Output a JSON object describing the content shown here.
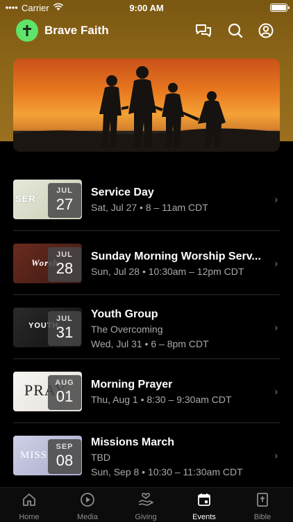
{
  "status_bar": {
    "carrier": "Carrier",
    "time": "9:00 AM"
  },
  "header": {
    "title": "Brave Faith",
    "icons": [
      "chat-icon",
      "search-icon",
      "profile-icon"
    ],
    "logo_color": "#5fe36a"
  },
  "hero": {
    "image": "silhouette-family-sunset"
  },
  "events": [
    {
      "thumb_text": "SER",
      "month": "JUL",
      "day": "27",
      "title": "Service Day",
      "lines": [
        "Sat, Jul 27 • 8 – 11am CDT"
      ]
    },
    {
      "thumb_text": "Worsh",
      "month": "JUL",
      "day": "28",
      "title": "Sunday Morning Worship Serv...",
      "lines": [
        "Sun, Jul 28 • 10:30am – 12pm CDT"
      ]
    },
    {
      "thumb_text": "YOUTH",
      "month": "JUL",
      "day": "31",
      "title": "Youth Group",
      "lines": [
        "The Overcoming",
        "Wed, Jul 31 • 6 – 8pm CDT"
      ]
    },
    {
      "thumb_text": "PRAY",
      "month": "AUG",
      "day": "01",
      "title": "Morning Prayer",
      "lines": [
        "Thu, Aug 1 • 8:30 – 9:30am CDT"
      ]
    },
    {
      "thumb_text": "MISS",
      "month": "SEP",
      "day": "08",
      "title": "Missions March",
      "lines": [
        "TBD",
        "Sun, Sep 8 • 10:30 – 11:30am CDT"
      ]
    }
  ],
  "tabs": [
    {
      "label": "Home",
      "icon": "home-icon",
      "active": false
    },
    {
      "label": "Media",
      "icon": "play-icon",
      "active": false
    },
    {
      "label": "Giving",
      "icon": "giving-icon",
      "active": false
    },
    {
      "label": "Events",
      "icon": "calendar-icon",
      "active": true
    },
    {
      "label": "Bible",
      "icon": "bible-icon",
      "active": false
    }
  ],
  "chevron": "›"
}
